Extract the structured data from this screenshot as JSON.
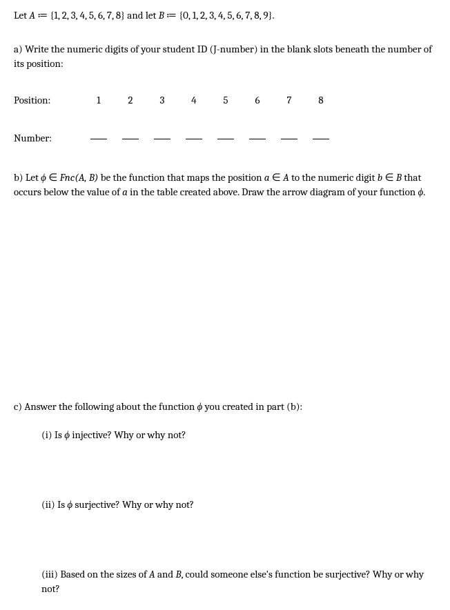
{
  "intro": {
    "text_pre": "Let ",
    "setA_name": "A",
    "assign": " ≔ ",
    "setA_val": "{1, 2, 3, 4, 5, 6, 7, 8}",
    "and": " and let ",
    "setB_name": "B",
    "setB_val": "{0, 1, 2, 3, 4, 5, 6, 7, 8, 9}",
    "period": "."
  },
  "partA": {
    "label": "a) Write the numeric digits of your student ID (J-number) in the blank slots beneath the number of its position:",
    "position_label": "Position:",
    "positions": [
      "1",
      "2",
      "3",
      "4",
      "5",
      "6",
      "7",
      "8"
    ],
    "number_label": "Number:"
  },
  "partB": {
    "prefix": "b) Let ",
    "phi": "ϕ",
    "in": " ∈ ",
    "fnc": "Fnc",
    "AB": "(A, B)",
    "mid1": " be the function that maps the position ",
    "a": "a",
    "inA": " ∈ ",
    "Aname": "A",
    "mid2": " to the numeric digit ",
    "b": "b",
    "inB": " ∈ ",
    "Bname": "B",
    "mid3": " that occurs below the value of ",
    "a2": "a",
    "mid4": " in the table created above. Draw the arrow diagram of your function ",
    "phi2": "ϕ",
    "period": "."
  },
  "partC": {
    "label_pre": "c) Answer the following about the function ",
    "phi": "ϕ",
    "label_post": " you created in part (b):",
    "sub1_pre": "(i) Is ",
    "sub1_phi": "ϕ",
    "sub1_post": " injective?  Why or why not?",
    "sub2_pre": "(ii) Is ",
    "sub2_phi": "ϕ",
    "sub2_post": " surjective? Why or why not?",
    "sub3_pre": "(iii) Based on the sizes of ",
    "sub3_A": "A",
    "sub3_and": " and ",
    "sub3_B": "B",
    "sub3_post": ", could someone else's function be surjective? Why or why not?"
  }
}
